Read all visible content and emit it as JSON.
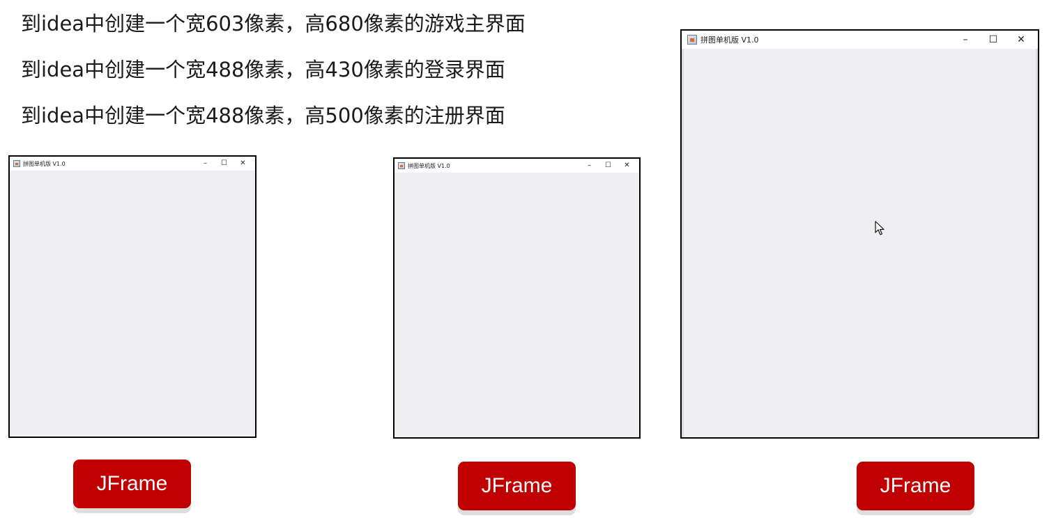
{
  "instructions": [
    "到idea中创建一个宽603像素，高680像素的游戏主界面",
    "到idea中创建一个宽488像素，高430像素的登录界面",
    "到idea中创建一个宽488像素，高500像素的注册界面"
  ],
  "windows": [
    {
      "title": "拼图单机版 V1.0",
      "minimize": "–",
      "maximize": "☐",
      "close": "✕",
      "label": "JFrame"
    },
    {
      "title": "拼图单机版 V1.0",
      "minimize": "–",
      "maximize": "☐",
      "close": "✕",
      "label": "JFrame"
    },
    {
      "title": "拼图单机版 V1.0",
      "minimize": "–",
      "maximize": "☐",
      "close": "✕",
      "label": "JFrame"
    }
  ],
  "colors": {
    "label_background": "#c00000",
    "window_content": "#efeef0",
    "window_border": "#000000"
  },
  "icons": {
    "app": "java-app-icon",
    "cursor": "mouse-pointer-icon"
  }
}
